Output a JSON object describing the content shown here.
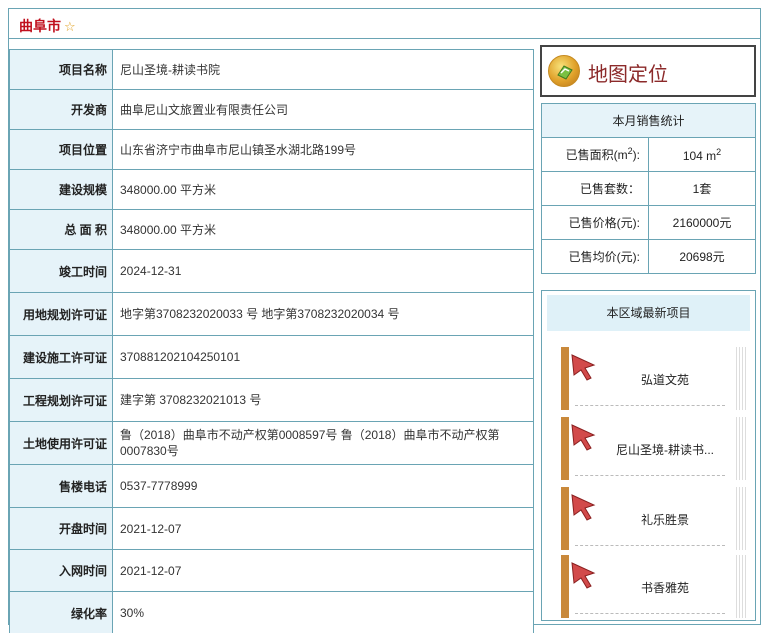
{
  "page": {
    "title": "曲阜市",
    "title_icon": "star-outline"
  },
  "info_rows": [
    {
      "label": "项目名称",
      "value": "尼山圣境-耕读书院"
    },
    {
      "label": "开发商",
      "value": "曲阜尼山文旅置业有限责任公司"
    },
    {
      "label": "项目位置",
      "value": "山东省济宁市曲阜市尼山镇圣水湖北路199号"
    },
    {
      "label": "建设规模",
      "value": "348000.00 平方米"
    },
    {
      "label": "总 面 积",
      "value": "348000.00 平方米"
    },
    {
      "label": "竣工时间",
      "value": "2024-12-31"
    },
    {
      "label": "用地规划许可证",
      "value": "地字第3708232020033 号 地字第3708232020034 号"
    },
    {
      "label": "建设施工许可证",
      "value": "370881202104250101"
    },
    {
      "label": "工程规划许可证",
      "value": "建字第 3708232021013 号"
    },
    {
      "label": "土地使用许可证",
      "value": "鲁（2018）曲阜市不动产权第0008597号 鲁（2018）曲阜市不动产权第0007830号"
    },
    {
      "label": "售楼电话",
      "value": "0537-7778999"
    },
    {
      "label": "开盘时间",
      "value": "2021-12-07"
    },
    {
      "label": "入网时间",
      "value": "2021-12-07"
    },
    {
      "label": "绿化率",
      "value": "30%"
    }
  ],
  "map_button": {
    "label": "地图定位",
    "icon": "map-globe-icon"
  },
  "sales": {
    "header": "本月销售统计",
    "area_label": "已售面积(m",
    "area_label_sup": "2",
    "area_label_end": "):",
    "area_value": "104 m",
    "area_value_sup": "2",
    "units_label": "已售套数：",
    "units_value": "1套",
    "price_label": "已售价格(元):",
    "price_value": "2160000元",
    "avg_label": "已售均价(元):",
    "avg_value": "20698元"
  },
  "region": {
    "header": "本区域最新项目",
    "projects": [
      {
        "name": "弘道文苑"
      },
      {
        "name": "尼山圣境-耕读书..."
      },
      {
        "name": "礼乐胜景"
      },
      {
        "name": "书香雅苑"
      }
    ]
  },
  "colors": {
    "border": "#6aa4b4",
    "label_bg": "#e6f3f9",
    "title_red": "#c0101e",
    "map_text": "#8c2a2a"
  }
}
